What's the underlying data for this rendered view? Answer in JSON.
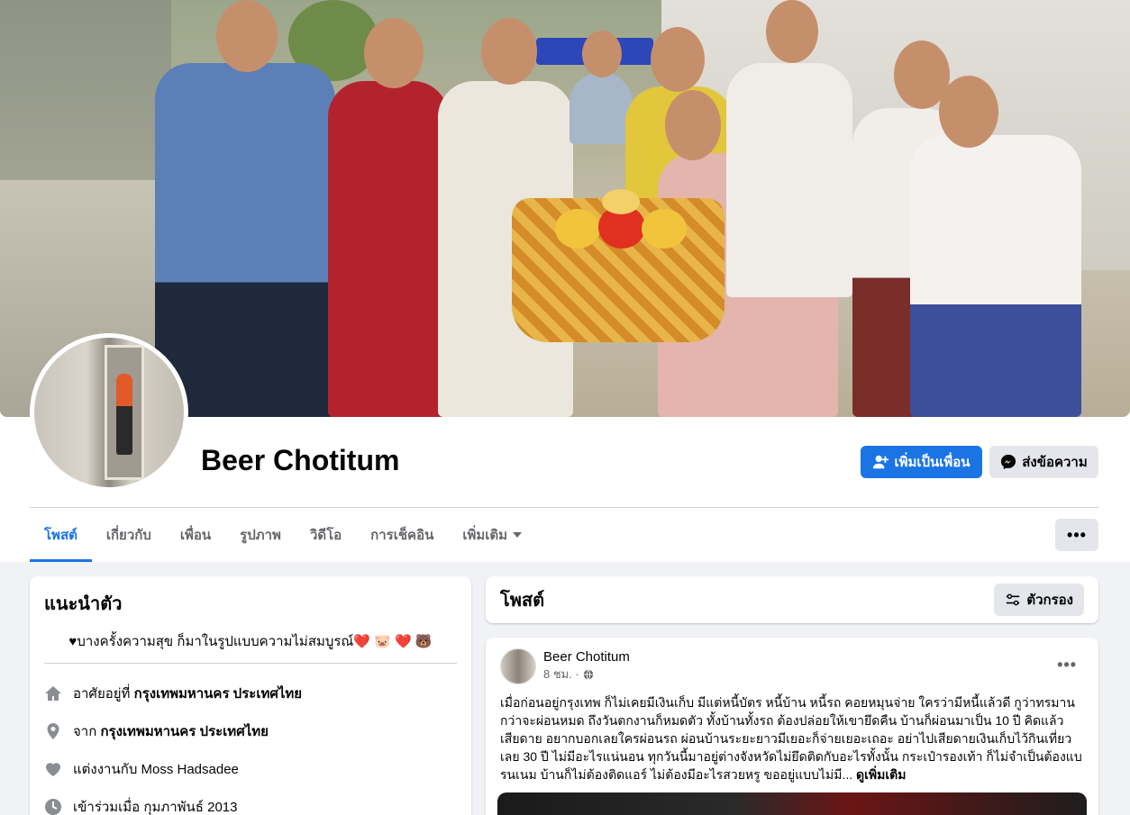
{
  "profile": {
    "name": "Beer Chotitum",
    "add_friend_label": "เพิ่มเป็นเพื่อน",
    "message_label": "ส่งข้อความ"
  },
  "tabs": [
    {
      "label": "โพสต์",
      "active": true
    },
    {
      "label": "เกี่ยวกับ"
    },
    {
      "label": "เพื่อน"
    },
    {
      "label": "รูปภาพ"
    },
    {
      "label": "วิดีโอ"
    },
    {
      "label": "การเช็คอิน"
    },
    {
      "label": "เพิ่มเติม"
    }
  ],
  "more_menu_label": "•••",
  "intro": {
    "title": "แนะนำตัว",
    "bio": "♥บางครั้งความสุข ก็มาในรูปแบบความไม่สมบูรณ์❤️ 🐷 ❤️ 🐻",
    "lives_prefix": "อาศัยอยู่ที่ ",
    "lives_value": "กรุงเทพมหานคร ประเทศไทย",
    "from_prefix": "จาก ",
    "from_value": "กรุงเทพมหานคร ประเทศไทย",
    "married": "แต่งงานกับ Moss Hadsadee",
    "joined": "เข้าร่วมเมื่อ กุมภาพันธ์ 2013"
  },
  "posts_section": {
    "title": "โพสต์",
    "filter_label": "ตัวกรอง"
  },
  "post": {
    "author": "Beer Chotitum",
    "time": "8 ชม. ·",
    "text": "เมื่อก่อนอยู่กรุงเทพ ก็ไม่เคยมีเงินเก็บ มีแต่หนี้บัตร หนี้บ้าน หนี้รถ คอยหมุนจ่าย ใครว่ามีหนี้แล้วดี กูว่าทรมาน กว่าจะผ่อนหมด ถึงวันตกงานก็หมดตัว ทั้งบ้านทั้งรถ ต้องปล่อยให้เขายึดคืน บ้านก็ผ่อนมาเป็น 10 ปี คิดแล้วเสียดาย อยากบอกเลยใครผ่อนรถ ผ่อนบ้านระยะยาวมีเยอะก็จ่ายเยอะเถอะ อย่าไปเสียดายเงินเก็บไว้กินเที่ยวเลย 30 ปี ไม่มีอะไรแน่นอน ทุกวันนี้มาอยู่ต่างจังหวัดไม่ยึดติดกับอะไรทั้งนั้น กระเป๋ารองเท้า ก็ไม่จำเป็นต้องแบรนเนม บ้านก็ไม่ต้องติดแอร์ ไม่ต้องมีอะไรสวยหรู ขออยู่แบบไม่มี...",
    "see_more": "ดูเพิ่มเติม",
    "menu_label": "•••"
  },
  "colors": {
    "accent": "#1b74e4",
    "background": "#f0f2f5",
    "secondary_button": "#e4e6eb",
    "muted_text": "#65676b"
  }
}
